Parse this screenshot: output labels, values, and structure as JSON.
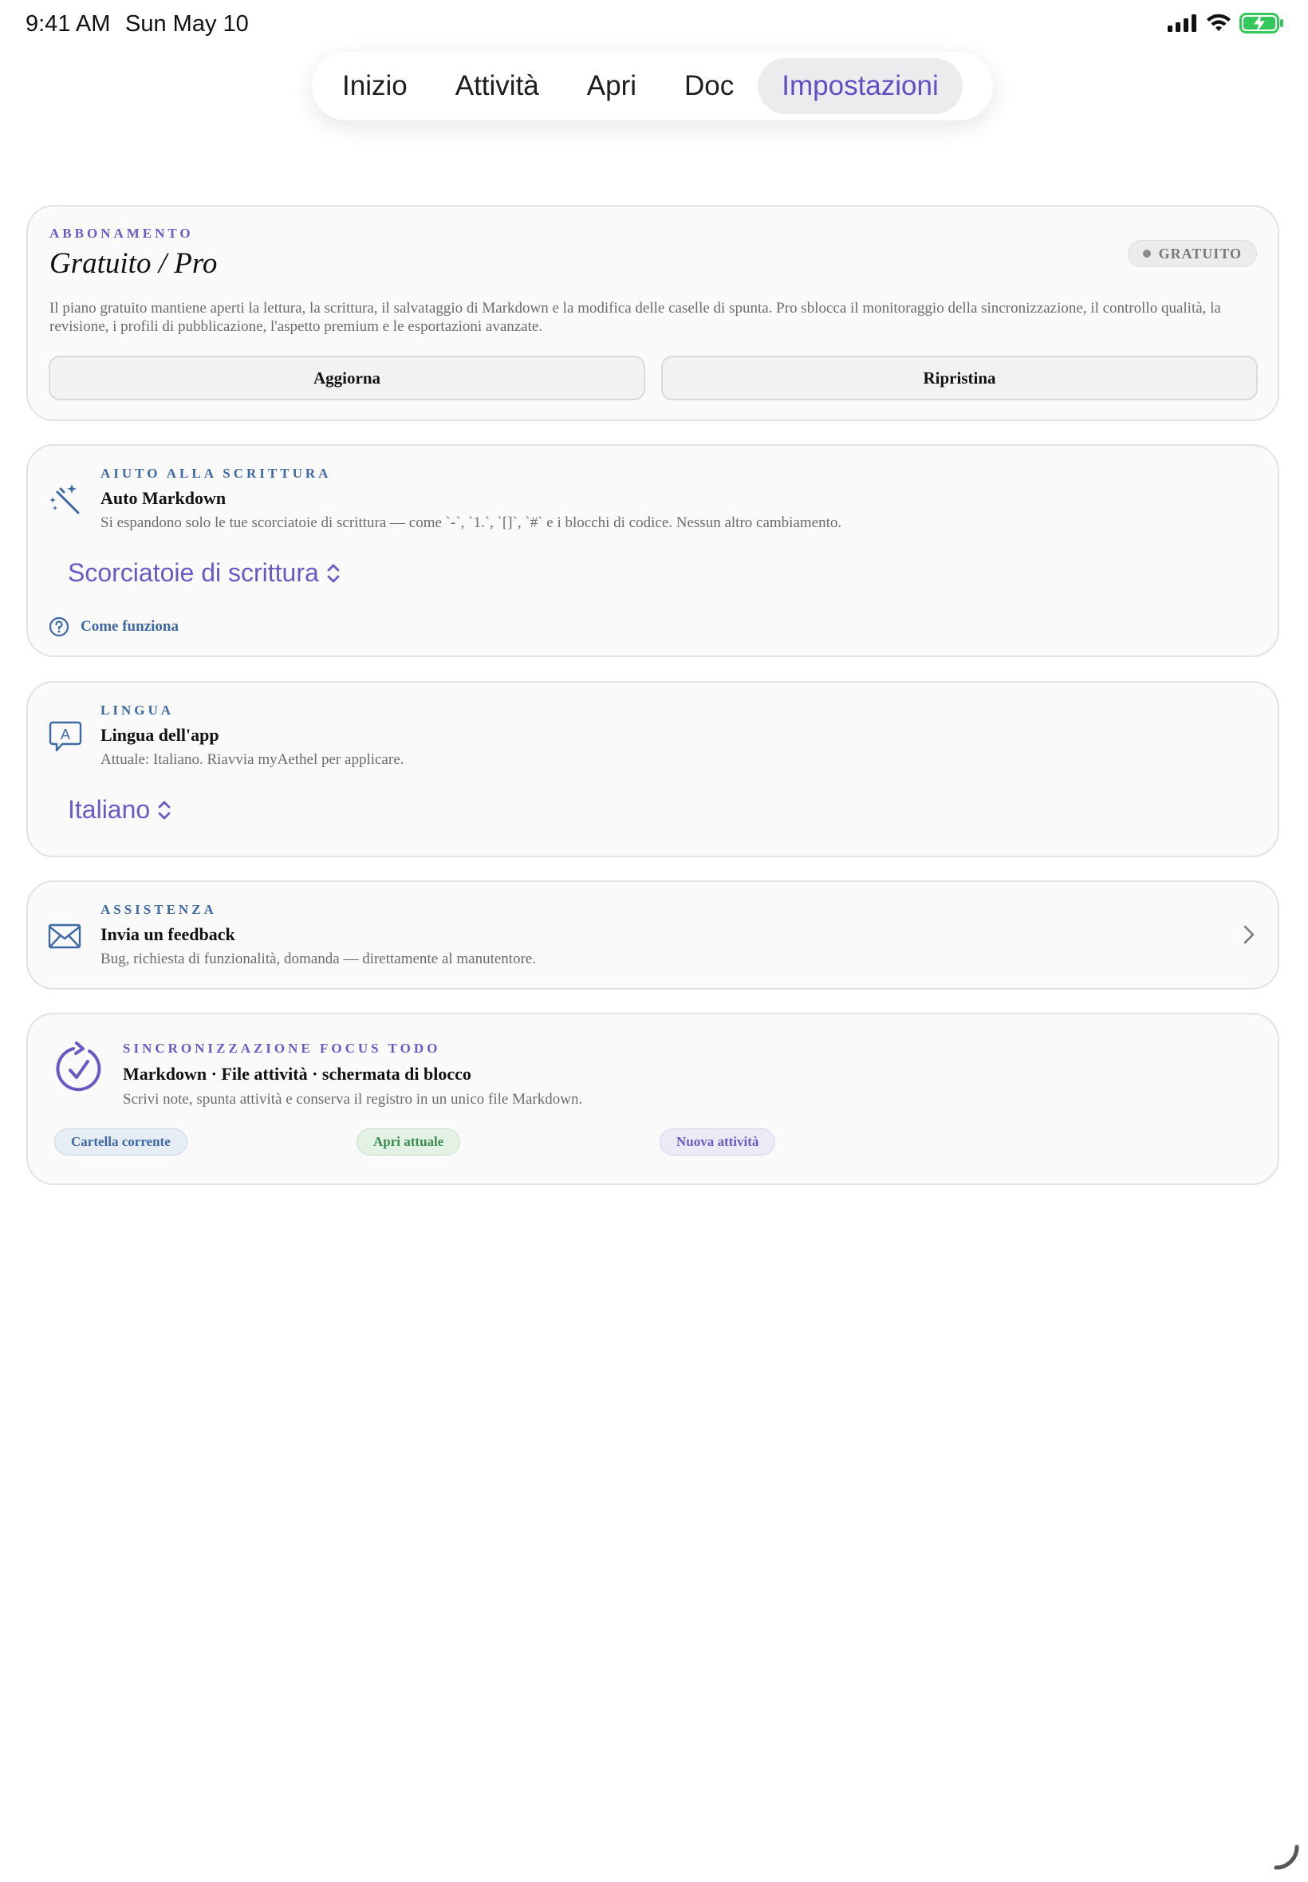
{
  "status_bar": {
    "time": "9:41 AM",
    "date": "Sun May 10"
  },
  "tabs": [
    {
      "label": "Inizio"
    },
    {
      "label": "Attività"
    },
    {
      "label": "Apri"
    },
    {
      "label": "Doc"
    },
    {
      "label": "Impostazioni",
      "active": true
    }
  ],
  "subscription": {
    "eyebrow": "ABBONAMENTO",
    "title": "Gratuito / Pro",
    "badge": "GRATUITO",
    "description": "Il piano gratuito mantiene aperti la lettura, la scrittura, il salvataggio di Markdown e la modifica delle caselle di spunta. Pro sblocca il monitoraggio della sincronizzazione, il controllo qualità, la revisione, i profili di pubblicazione, l'aspetto premium e le esportazioni avanzate.",
    "upgrade_label": "Aggiorna",
    "restore_label": "Ripristina"
  },
  "writing_help": {
    "eyebrow": "AIUTO ALLA SCRITTURA",
    "title": "Auto Markdown",
    "description": "Si espandono solo le tue scorciatoie di scrittura — come `-`, `1.`, `[]`, `#` e i blocchi di codice. Nessun altro cambiamento.",
    "picker_value": "Scorciatoie di scrittura",
    "how_it_works": "Come funziona"
  },
  "language": {
    "eyebrow": "LINGUA",
    "title": "Lingua dell'app",
    "description": "Attuale: Italiano. Riavvia myAethel per applicare.",
    "picker_value": "Italiano"
  },
  "support": {
    "eyebrow": "ASSISTENZA",
    "title": "Invia un feedback",
    "description": "Bug, richiesta di funzionalità, domanda — direttamente al manutentore."
  },
  "sync": {
    "eyebrow": "SINCRONIZZAZIONE FOCUS TODO",
    "title": "Markdown · File attività · schermata di blocco",
    "description": "Scrivi note, spunta attività e conserva il registro in un unico file Markdown.",
    "pills": [
      "Cartella corrente",
      "Apri attuale",
      "Nuova attività"
    ]
  },
  "colors": {
    "accent_purple": "#6a5ac6",
    "accent_blue": "#3e68a3",
    "battery_green": "#34c759"
  }
}
